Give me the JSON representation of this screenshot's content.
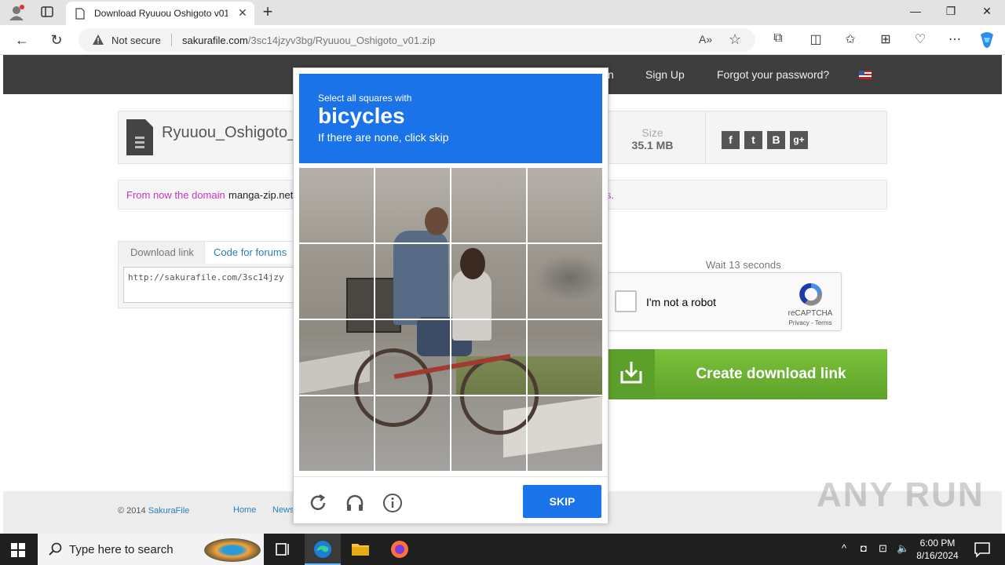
{
  "browser": {
    "tab_title": "Download Ryuuou Oshigoto v01",
    "security_label": "Not secure",
    "url_domain": "sakurafile.com",
    "url_path": "/3sc14jzyv3bg/Ryuuou_Oshigoto_v01.zip"
  },
  "site": {
    "nav": {
      "partial_link": "n",
      "signup": "Sign Up",
      "forgot": "Forgot your password?"
    },
    "file": {
      "name": "Ryuuou_Oshigoto_v",
      "size_label": "Size",
      "size_value": "35.1 MB",
      "social": [
        "f",
        "t",
        "B",
        "g+"
      ]
    },
    "notice": {
      "prefix": "From now the domain",
      "domain": "manga-zip.net",
      "suffix": "rks."
    },
    "download": {
      "tab_link": "Download link",
      "tab_forums": "Code for forums",
      "link_value": "http://sakurafile.com/3sc14jzy"
    },
    "wait_text": "Wait 13 seconds",
    "recaptcha": {
      "label": "I'm not a robot",
      "brand": "reCAPTCHA",
      "terms": "Privacy - Terms"
    },
    "create_button": "Create download link",
    "footer": {
      "copyright": "© 2014",
      "brand": "SakuraFile",
      "links": [
        "Home",
        "News"
      ]
    },
    "watermark": "ANY RUN"
  },
  "challenge": {
    "instruction": "Select all squares with",
    "target": "bicycles",
    "hint": "If there are none, click skip",
    "grid_size": 4,
    "skip_label": "SKIP",
    "header_color": "#1a73e8"
  },
  "taskbar": {
    "search_placeholder": "Type here to search",
    "time": "6:00 PM",
    "date": "8/16/2024"
  }
}
